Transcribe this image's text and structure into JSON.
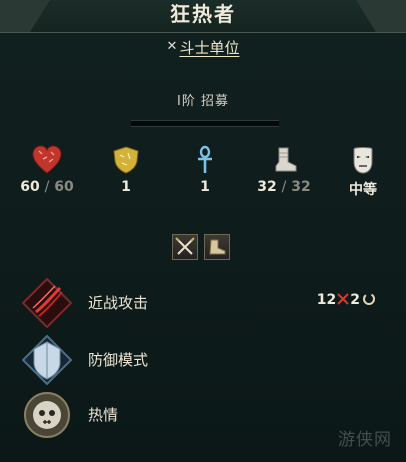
{
  "title": "狂热者",
  "unit_type": "斗士单位",
  "tier": "I阶  招募",
  "stats": {
    "hp": {
      "current": "60",
      "sep": "/",
      "max": "60"
    },
    "defense": "1",
    "resolve": "1",
    "movement": {
      "current": "32",
      "sep": "/",
      "max": "32"
    },
    "morale": "中等"
  },
  "icons": [
    "heart-icon",
    "shield-icon",
    "ankh-icon",
    "boot-icon",
    "mask-icon",
    "crossed-swords-icon",
    "boot-trait-icon"
  ],
  "abilities": [
    {
      "label": "近战攻击",
      "damage": "12",
      "hits": "2"
    },
    {
      "label": "防御模式"
    },
    {
      "label": "热情"
    }
  ],
  "watermark": "游侠网"
}
